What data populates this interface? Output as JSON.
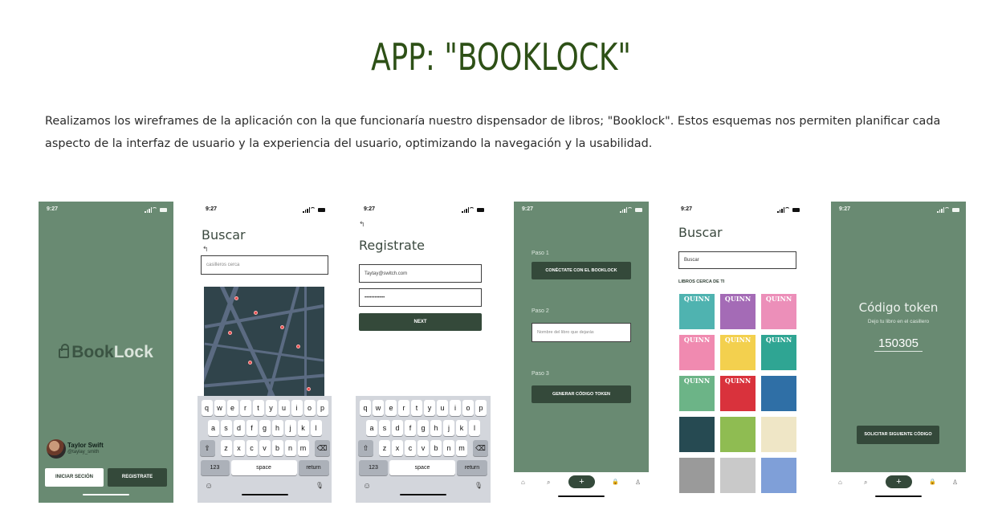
{
  "header": {
    "title": "APP: \"BOOKLOCK\"",
    "description": "Realizamos los wireframes de la aplicación con la que funcionaría nuestro dispensador de libros; \"Booklock\". Estos esquemas nos permiten planificar cada aspecto de la interfaz de usuario y la experiencia del usuario, optimizando la navegación y la usabilidad."
  },
  "status_time": "9:27",
  "colors": {
    "title": "#2d5016",
    "screen_green": "#698a72",
    "button_dark": "#34493a"
  },
  "screen_welcome": {
    "logo_book": "Book",
    "logo_lock": "Lock",
    "user_name": "Taylor Swift",
    "user_handle": "@taylay_smith",
    "login_button": "INICIAR SECIÓN",
    "register_button": "REGISTRATE"
  },
  "screen_map_search": {
    "title": "Buscar",
    "search_placeholder": "casilleros cerca"
  },
  "screen_register": {
    "title": "Registrate",
    "email_value": "Taytay@switch.com",
    "password_value": "••••••••••••",
    "next_button": "NEXT"
  },
  "keyboard": {
    "row1": [
      "q",
      "w",
      "e",
      "r",
      "t",
      "y",
      "u",
      "i",
      "o",
      "p"
    ],
    "row2": [
      "a",
      "s",
      "d",
      "f",
      "g",
      "h",
      "j",
      "k",
      "l"
    ],
    "row3": [
      "z",
      "x",
      "c",
      "v",
      "b",
      "n",
      "m"
    ],
    "shift": "⇧",
    "backspace": "⌫",
    "numbers": "123",
    "space": "space",
    "return": "return",
    "emoji": "☺",
    "mic": "🎙"
  },
  "screen_steps": {
    "step1_label": "Paso 1",
    "connect_button": "CONÉCTATE CON EL BOOKLOCK",
    "step2_label": "Paso 2",
    "book_placeholder": "Nombre del libro que dejarás",
    "step3_label": "Paso 3",
    "token_button": "GENERAR CÓDIGO TOKEN"
  },
  "screen_books": {
    "title": "Buscar",
    "search_placeholder": "Buscar",
    "section_label": "LIBROS CERCA DE TI",
    "books": [
      {
        "label": "QUINN",
        "color": "#4fb3b0"
      },
      {
        "label": "QUINN",
        "color": "#a46bb6"
      },
      {
        "label": "QUINN",
        "color": "#ec8fb9"
      },
      {
        "label": "QUINN",
        "color": "#f08ab0"
      },
      {
        "label": "QUINN",
        "color": "#f3d04e"
      },
      {
        "label": "QUINN",
        "color": "#2fa593"
      },
      {
        "label": "QUINN",
        "color": "#6cb487"
      },
      {
        "label": "QUINN",
        "color": "#d9323c"
      },
      {
        "label": "",
        "color": "#2f6fa6"
      },
      {
        "label": "",
        "color": "#264a52"
      },
      {
        "label": "",
        "color": "#8fbc52"
      },
      {
        "label": "",
        "color": "#efe6c6"
      },
      {
        "label": "",
        "color": "#9a9a9a"
      },
      {
        "label": "",
        "color": "#c9c9c9"
      },
      {
        "label": "",
        "color": "#7f9fd8"
      }
    ]
  },
  "screen_token": {
    "title": "Código token",
    "subtitle": "Dejo tu libro en el casillero",
    "code": "150305",
    "next_button": "SOLICITAR SIGUIENTE CÓDIGO"
  },
  "navbar": {
    "home_icon": "⌂",
    "search_icon": "⌕",
    "plus": "+",
    "lock_icon": "🔒",
    "user_icon": "♙"
  }
}
